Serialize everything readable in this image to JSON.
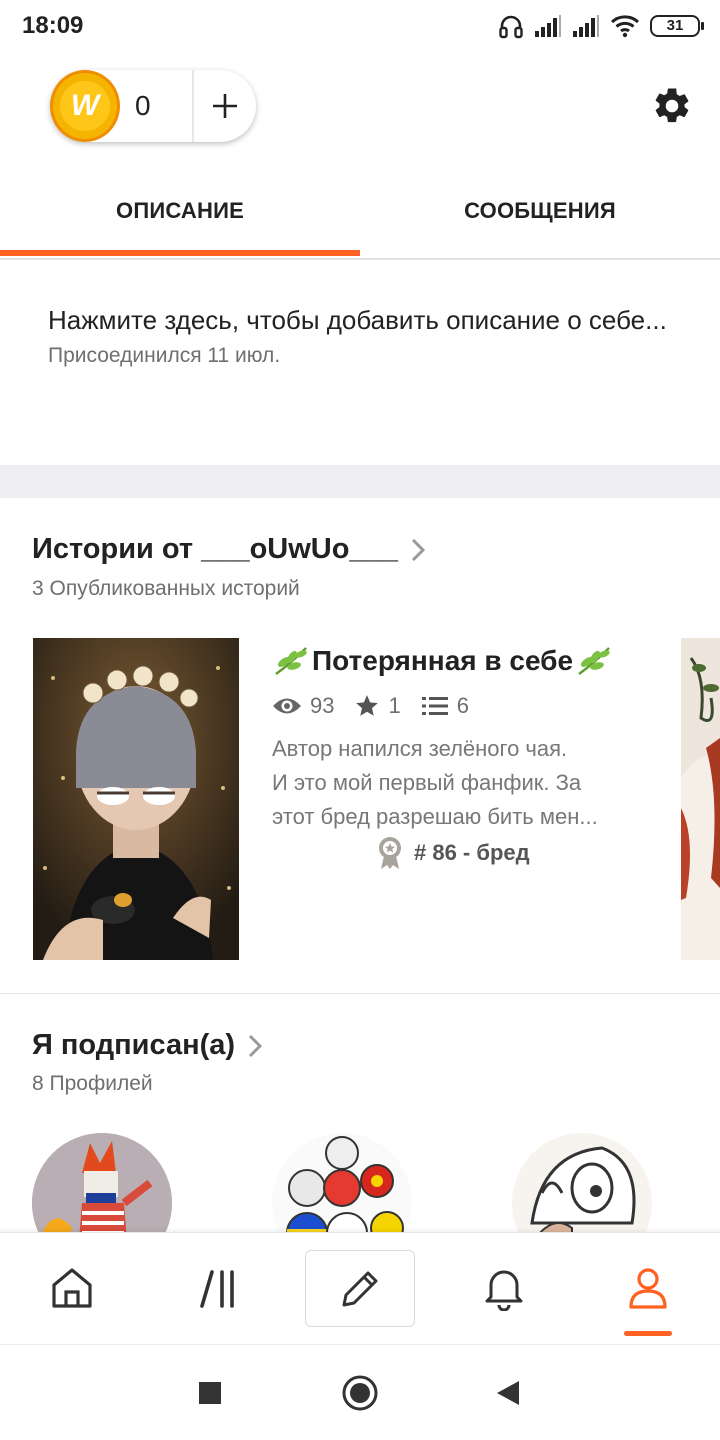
{
  "status_bar": {
    "time": "18:09",
    "battery": "31"
  },
  "header": {
    "coin_count": "0",
    "coin_logo": "W"
  },
  "tabs": [
    {
      "label": "ОПИСАНИЕ",
      "active": true
    },
    {
      "label": "СООБЩЕНИЯ",
      "active": false
    }
  ],
  "about": {
    "description": "Нажмите здесь, чтобы добавить описание о себе...",
    "joined": "Присоединился 11 июл."
  },
  "stories": {
    "title": "Истории от ___oUwUo___",
    "subtitle": "3 Опубликованных историй",
    "items": [
      {
        "title": "Потерянная в себе",
        "views": "93",
        "votes": "1",
        "parts": "6",
        "description_lines": [
          "Автор напился зелёного чая.",
          "И это мой первый фанфик. За",
          "этот бред разрешаю бить мен..."
        ],
        "tag": "# 86 - бред"
      }
    ]
  },
  "following": {
    "title": "Я подписан(а)",
    "subtitle": "8 Профилей"
  },
  "bottom_nav": {
    "items": [
      "home-icon",
      "library-icon",
      "write-icon",
      "notifications-icon",
      "profile-icon"
    ],
    "active": "profile-icon"
  },
  "colors": {
    "accent": "#ff6122",
    "coin": "#f4b400"
  }
}
